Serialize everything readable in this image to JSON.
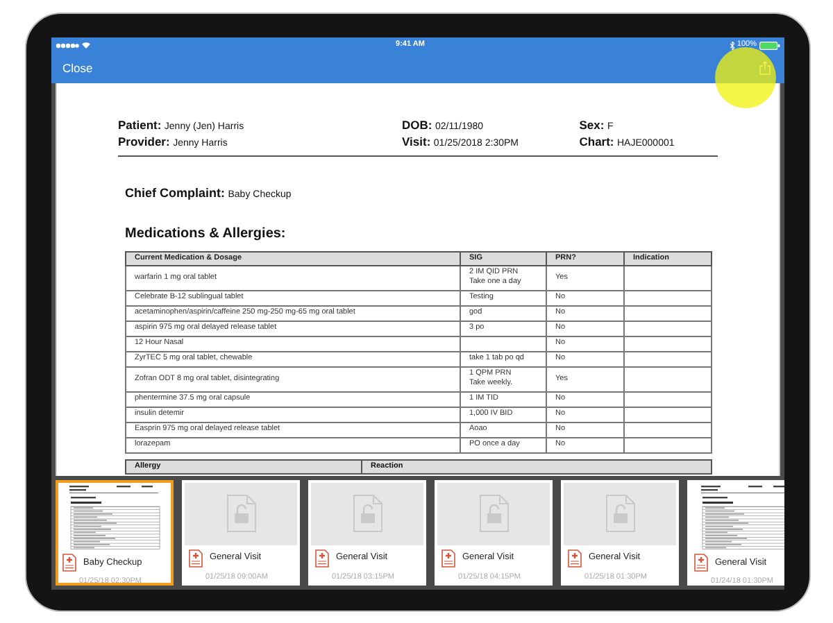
{
  "status_bar": {
    "time": "9:41 AM",
    "battery": "100%"
  },
  "nav_bar": {
    "close": "Close"
  },
  "document": {
    "header_columns": [
      [
        {
          "label": "Patient:",
          "value": "Jenny (Jen) Harris"
        },
        {
          "label": "Provider:",
          "value": "Jenny Harris"
        }
      ],
      [
        {
          "label": "DOB:",
          "value": "02/11/1980"
        },
        {
          "label": "Visit:",
          "value": "01/25/2018 2:30PM"
        }
      ],
      [
        {
          "label": "Sex:",
          "value": "F"
        },
        {
          "label": "Chart:",
          "value": "HAJE000001"
        }
      ]
    ],
    "chief_complaint": {
      "label": "Chief Complaint:",
      "value": "Baby Checkup"
    },
    "section_title": "Medications & Allergies:",
    "medications_table": {
      "columns": [
        "Current Medication & Dosage",
        "SIG",
        "PRN?",
        "Indication"
      ],
      "rows": [
        {
          "medication": "warfarin 1 mg oral tablet",
          "sig": [
            "2 IM QID PRN",
            "Take one a day"
          ],
          "prn": "Yes"
        },
        {
          "medication": "Celebrate B-12 sublingual tablet",
          "sig": [
            "Testing"
          ],
          "prn": "No"
        },
        {
          "medication": "acetaminophen/aspirin/caffeine 250 mg-250 mg-65 mg oral tablet",
          "sig": [
            "god"
          ],
          "prn": "No"
        },
        {
          "medication": "aspirin 975 mg oral delayed release tablet",
          "sig": [
            "3 po"
          ],
          "prn": "No"
        },
        {
          "medication": "12 Hour Nasal",
          "prn": "No"
        },
        {
          "medication": "ZyrTEC 5 mg oral tablet, chewable",
          "sig": [
            "take 1 tab po qd"
          ],
          "prn": "No"
        },
        {
          "medication": "Zofran ODT 8 mg oral tablet, disintegrating",
          "sig": [
            "1 QPM PRN",
            "Take weekly."
          ],
          "prn": "Yes"
        },
        {
          "medication": "phentermine 37.5 mg oral capsule",
          "sig": [
            "1 IM TID"
          ],
          "prn": "No"
        },
        {
          "medication": "insulin detemir",
          "sig": [
            "1,000 IV BID"
          ],
          "prn": "No"
        },
        {
          "medication": "Easprin 975 mg oral delayed release tablet",
          "sig": [
            "Aoao"
          ],
          "prn": "No"
        },
        {
          "medication": "lorazepam",
          "sig": [
            "PO once a day"
          ],
          "prn": "No"
        }
      ]
    },
    "allergy_table": {
      "columns": [
        "Allergy",
        "Reaction"
      ]
    }
  },
  "visits": [
    {
      "kind": "preview",
      "title": "Baby Checkup",
      "date": "01/25/18 02:30PM",
      "selected": true
    },
    {
      "kind": "locked",
      "title": "General Visit",
      "date": "01/25/18 09:00AM",
      "selected": false
    },
    {
      "kind": "locked",
      "title": "General Visit",
      "date": "01/25/18 03:15PM",
      "selected": false
    },
    {
      "kind": "locked",
      "title": "General Visit",
      "date": "01/25/18 04:15PM",
      "selected": false
    },
    {
      "kind": "locked",
      "title": "General Visit",
      "date": "01/25/18 01:30PM",
      "selected": false
    },
    {
      "kind": "preview",
      "title": "General Visit",
      "date": "01/24/18 01:30PM",
      "selected": false
    }
  ]
}
